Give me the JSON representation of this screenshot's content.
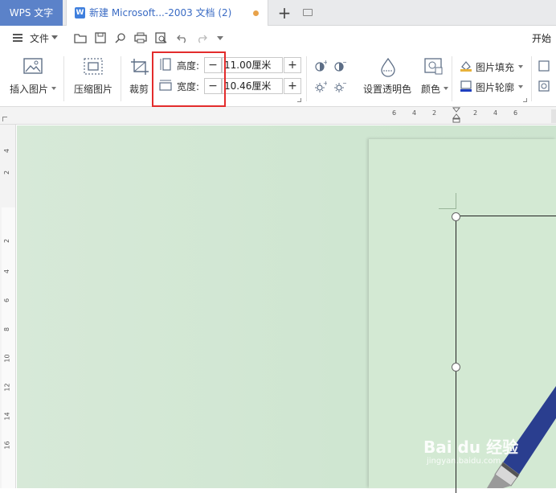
{
  "tabs": {
    "app": "WPS 文字",
    "document": "新建 Microsoft...-2003 文档 (2)",
    "new_tab": "+"
  },
  "menu": {
    "file": "文件",
    "start": "开始"
  },
  "ribbon": {
    "insert_picture": "插入图片",
    "compress_picture": "压缩图片",
    "crop": "裁剪",
    "height_label": "高度:",
    "height_value": "11.00厘米",
    "width_label": "宽度:",
    "width_value": "10.46厘米",
    "minus": "−",
    "plus": "+",
    "set_transparent": "设置透明色",
    "color": "颜色",
    "picture_fill": "图片填充",
    "picture_outline": "图片轮廓"
  },
  "ruler": {
    "horizontal": [
      "6",
      "4",
      "2",
      "2",
      "4",
      "6"
    ],
    "vertical": [
      "4",
      "2",
      "2",
      "4",
      "6",
      "8",
      "10",
      "12",
      "14",
      "16"
    ]
  },
  "watermark": {
    "main": "Bai du 经验",
    "sub": "jingyan.baidu.com"
  },
  "colors": {
    "app_tab": "#5b82c9",
    "highlight": "#e32c2c",
    "canvas": "#cfe6d1"
  }
}
